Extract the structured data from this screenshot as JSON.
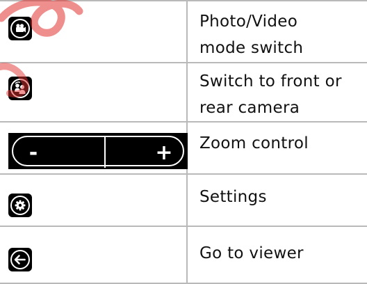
{
  "rows": [
    {
      "icon": "video-camera-icon",
      "label_line1": "Photo/Video",
      "label_line2": "mode switch"
    },
    {
      "icon": "switch-camera-icon",
      "label_line1": "Switch to front or",
      "label_line2": "rear camera"
    },
    {
      "icon": "zoom-control",
      "label_line1": "Zoom control",
      "zoom_minus": "-",
      "zoom_plus": "+"
    },
    {
      "icon": "gear-icon",
      "label_line1": "Settings"
    },
    {
      "icon": "back-arrow-icon",
      "label_line1": "Go to viewer"
    }
  ],
  "colors": {
    "icon_bg": "#000000",
    "icon_fg": "#ffffff",
    "grid": "#b9b9b9",
    "watermark": "#e0312f"
  }
}
